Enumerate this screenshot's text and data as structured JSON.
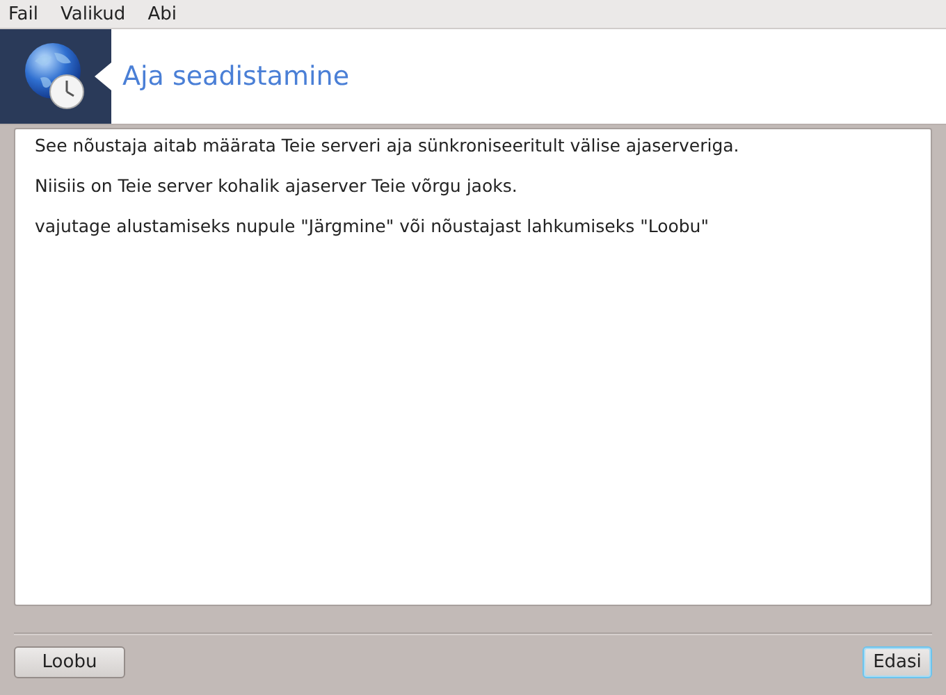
{
  "menu": [
    "Fail",
    "Valikud",
    "Abi"
  ],
  "header": {
    "title": "Aja seadistamine"
  },
  "paragraphs": [
    "See nõustaja aitab määrata Teie serveri aja sünkroniseeritult välise ajaserveriga.",
    "Niisiis on Teie server kohalik ajaserver Teie võrgu jaoks.",
    "vajutage alustamiseks nupule \"Järgmine\" või nõustajast lahkumiseks \"Loobu\""
  ],
  "buttons": [
    {
      "label": "Loobu",
      "focused": false
    },
    {
      "label": "Edasi",
      "focused": true
    }
  ]
}
